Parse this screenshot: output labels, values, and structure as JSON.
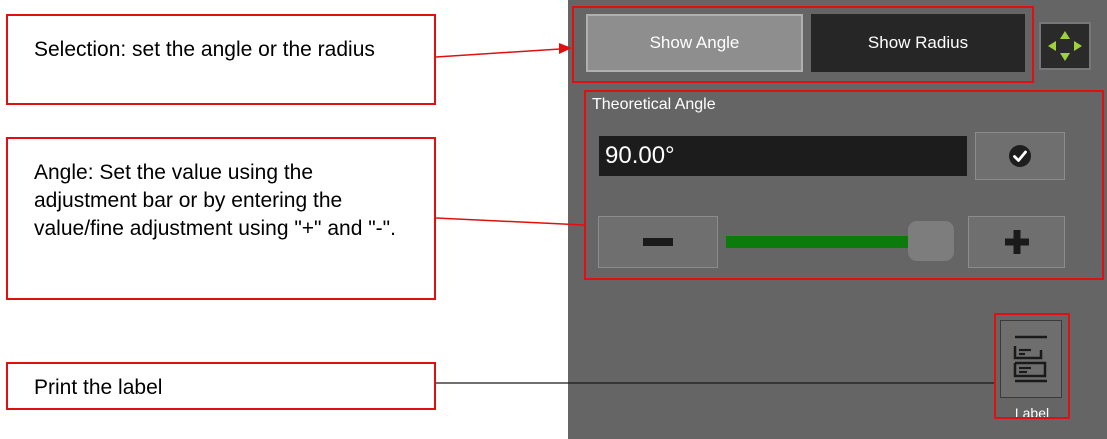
{
  "callouts": {
    "mode_selection": "Selection: set the angle or the radius",
    "angle_setting": "Angle: Set the value using the adjustment bar or by entering the value/fine adjustment using \"+\" and \"-\".",
    "print_label": "Print the label"
  },
  "panel": {
    "tabs": {
      "show_angle": "Show Angle",
      "show_radius": "Show Radius",
      "active": "Show Angle"
    },
    "move_icon": "move-arrows-icon",
    "section_title": "Theoretical Angle",
    "angle_value": "90.00°",
    "confirm_icon": "check-circle-icon",
    "minus_icon": "minus-icon",
    "plus_icon": "plus-icon",
    "slider": {
      "fill_fraction": 0.95
    },
    "label_button": {
      "caption": "Label",
      "icon": "label-print-icon"
    }
  },
  "colors": {
    "annotation": "#e01010",
    "panel_background": "#656565",
    "slider_fill": "#0b7c0b",
    "active_tab": "#8e8e8e",
    "inactive_tab": "#262626"
  }
}
